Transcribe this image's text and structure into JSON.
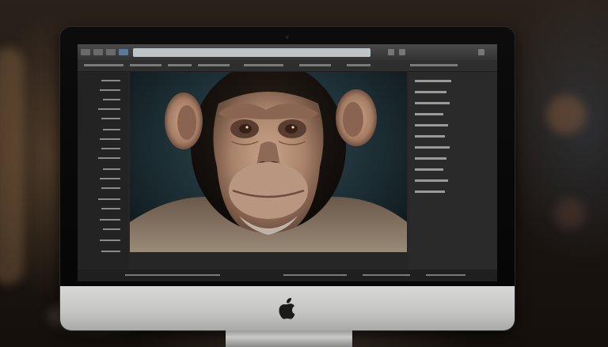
{
  "scene": {
    "subject": "chimpanzee-portrait",
    "device": "imac-monitor",
    "colors": {
      "background": "#1a1410",
      "bezel": "#0a0a0a",
      "chin": "#c8c8c6",
      "screen_bg": "#262626",
      "image_bg": "#1c2e34",
      "fur_dark": "#1b1510",
      "face_skin": "#b9937a",
      "ear_skin": "#c29c82"
    }
  },
  "window": {
    "address_text": "",
    "icons": [
      "back-icon",
      "forward-icon",
      "reload-icon",
      "view-icon"
    ]
  }
}
